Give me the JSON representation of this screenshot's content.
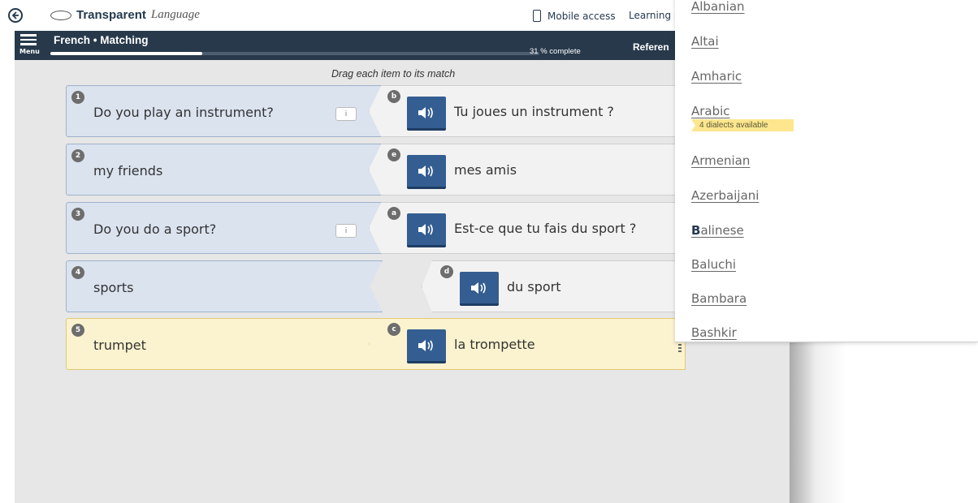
{
  "topbar": {
    "logo_bold": "Transparent",
    "logo_italic": "Language",
    "mobile_access": "Mobile access",
    "learning_link": "Learning po"
  },
  "header": {
    "menu_label": "Menu",
    "title": "French • Matching",
    "progress_fraction": 0.31,
    "progress_text": "31 % complete",
    "reference_label": "Referen"
  },
  "exercise": {
    "instruction": "Drag each item to its match",
    "info_label": "i",
    "rows": [
      {
        "num": "1",
        "prompt": "Do you play an instrument?",
        "letter": "b",
        "answer": "Tu joues un instrument ?"
      },
      {
        "num": "2",
        "prompt": "my friends",
        "letter": "e",
        "answer": "mes amis"
      },
      {
        "num": "3",
        "prompt": "Do you do a sport?",
        "letter": "a",
        "answer": "Est-ce que tu fais du sport ?"
      },
      {
        "num": "4",
        "prompt": "sports",
        "letter": "d",
        "answer": "du sport"
      },
      {
        "num": "5",
        "prompt": "trumpet",
        "letter": "c",
        "answer": "la trompette"
      }
    ]
  },
  "languages": {
    "items": [
      "Albanian",
      "Altai",
      "Amharic",
      "Arabic",
      "Armenian",
      "Azerbaijani",
      "alinese",
      "Baluchi",
      "Bambara",
      "Bashkir"
    ],
    "highlight_prefix": "B",
    "arabic_badge": "4 dialects available"
  },
  "colors": {
    "header_bg": "#27394b",
    "audio_button": "#345e91",
    "left_card": "#dbe3ef",
    "active_row": "#fbf3cf",
    "dialect_badge": "#fde68e"
  }
}
